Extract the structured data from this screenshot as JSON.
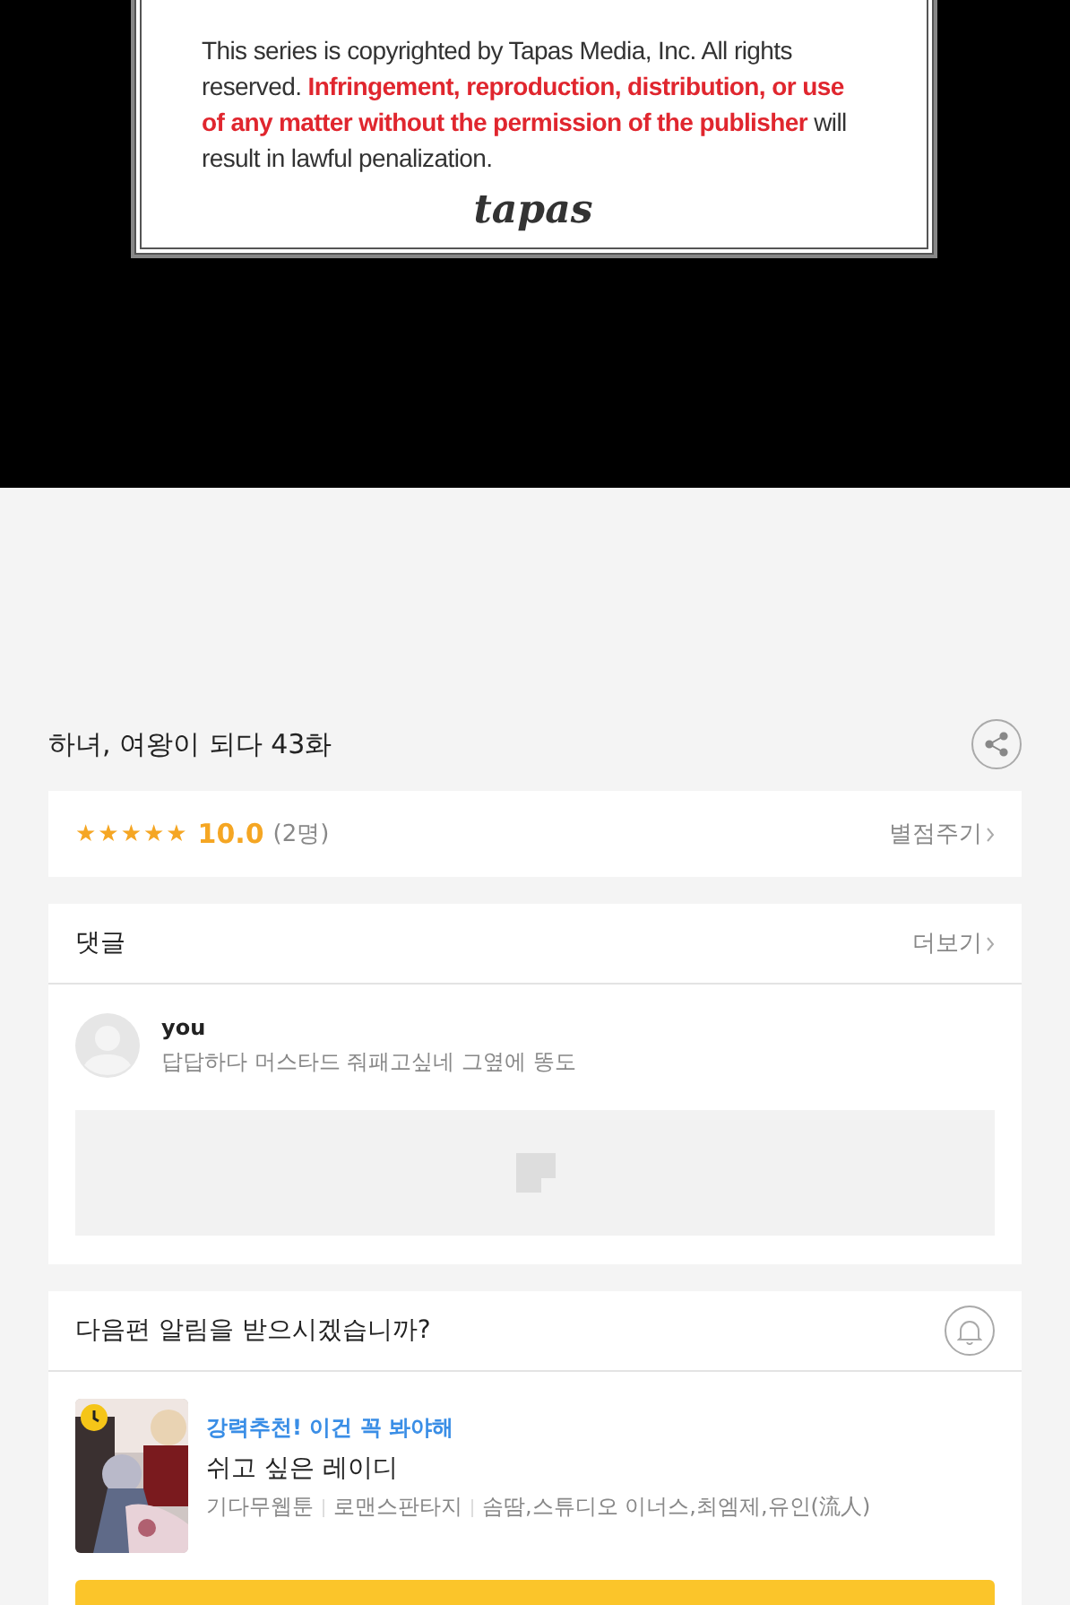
{
  "notice": {
    "text": "This series is copyrighted by Tapas Media, Inc. All rights reserved. **Infringement, reproduction, distribution, or use of any matter without the permission of the publisher** will result in lawful penalization.",
    "logo": "tapas"
  },
  "episode": {
    "title": "하녀, 여왕이 되다 43화"
  },
  "rating": {
    "stars": 5,
    "score": "10.0",
    "count": "(2명)",
    "action": "별점주기"
  },
  "comments": {
    "title": "댓글",
    "more": "더보기",
    "items": [
      {
        "user": "you",
        "text": "답답하다 머스타드 줘패고싶네 그옆에 똥도"
      }
    ]
  },
  "notify": {
    "question": "다음편 알림을 받으시겠습니까?",
    "recommendation": {
      "kind": "picture",
      "tagline": "강력추천! 이건 꼭 봐야해",
      "title": "쉬고 싶은 레이디",
      "meta": [
        "기다무웹툰",
        "로맨스판타지",
        "솜땀,스튜디오 이너스,최엠제,유인(流人)"
      ]
    }
  }
}
